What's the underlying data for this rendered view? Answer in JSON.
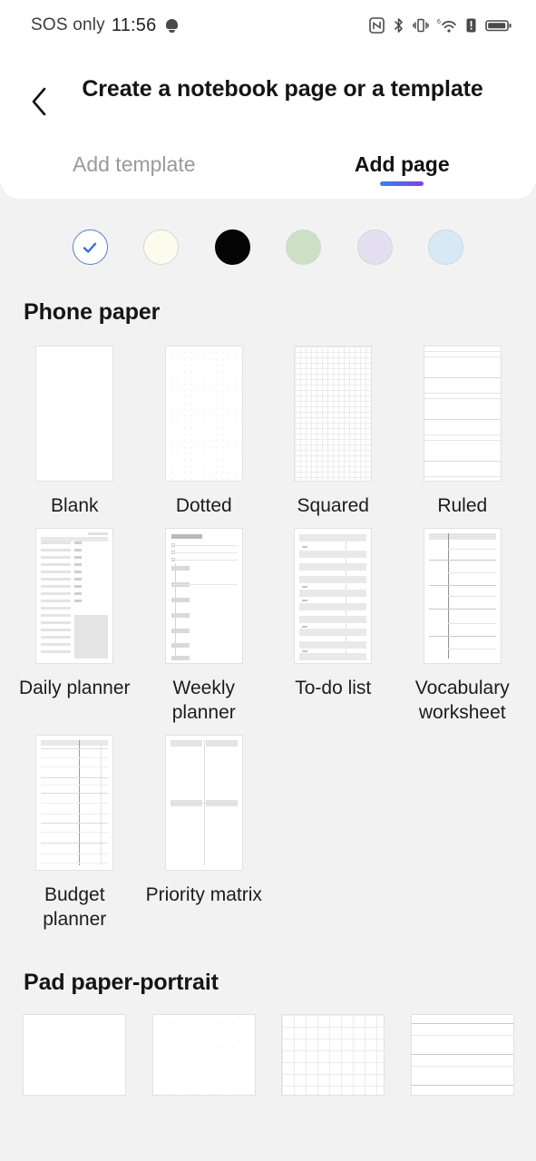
{
  "statusbar": {
    "carrier": "SOS only",
    "time": "11:56",
    "icons_left": [
      "notification-bell-icon"
    ],
    "icons_right": [
      "nfc-icon",
      "bluetooth-icon",
      "vibrate-icon",
      "wifi-6-icon",
      "alert-icon",
      "battery-icon"
    ]
  },
  "header": {
    "back_icon": "chevron-left-icon",
    "title": "Create a notebook page or a template",
    "tabs": [
      {
        "label": "Add template",
        "active": false
      },
      {
        "label": "Add page",
        "active": true
      }
    ],
    "active_tab_gradient_from": "#3b7ff0",
    "active_tab_gradient_to": "#7b45e0"
  },
  "colors": {
    "selected_index": 0,
    "check_icon": "check-icon",
    "check_color": "#3f6fd0",
    "swatches": [
      {
        "name": "white",
        "hex": "#ffffff",
        "selected": true
      },
      {
        "name": "cream",
        "hex": "#fcfcee",
        "selected": false
      },
      {
        "name": "black",
        "hex": "#050505",
        "selected": false
      },
      {
        "name": "green",
        "hex": "#cbe0c4",
        "selected": false
      },
      {
        "name": "lavender",
        "hex": "#e4dff0",
        "selected": false
      },
      {
        "name": "blue",
        "hex": "#d8e9f6",
        "selected": false
      }
    ]
  },
  "sections": [
    {
      "title": "Phone paper",
      "items": [
        {
          "label": "Blank",
          "pattern": "blank"
        },
        {
          "label": "Dotted",
          "pattern": "dotted"
        },
        {
          "label": "Squared",
          "pattern": "squared"
        },
        {
          "label": "Ruled",
          "pattern": "ruled"
        },
        {
          "label": "Daily planner",
          "pattern": "daily-planner"
        },
        {
          "label": "Weekly planner",
          "pattern": "weekly-planner"
        },
        {
          "label": "To-do list",
          "pattern": "todo-list"
        },
        {
          "label": "Vocabulary worksheet",
          "pattern": "vocabulary-worksheet"
        },
        {
          "label": "Budget planner",
          "pattern": "budget-planner"
        },
        {
          "label": "Priority matrix",
          "pattern": "priority-matrix"
        }
      ]
    },
    {
      "title": "Pad paper-portrait",
      "items": [
        {
          "label": "",
          "pattern": "blank"
        },
        {
          "label": "",
          "pattern": "dotted"
        },
        {
          "label": "",
          "pattern": "squared"
        },
        {
          "label": "",
          "pattern": "ruled"
        }
      ]
    }
  ],
  "theme": {
    "page_background": "#f2f2f2",
    "card_background": "#ffffff",
    "text_primary": "#141414",
    "text_muted": "#9a9a9a"
  }
}
